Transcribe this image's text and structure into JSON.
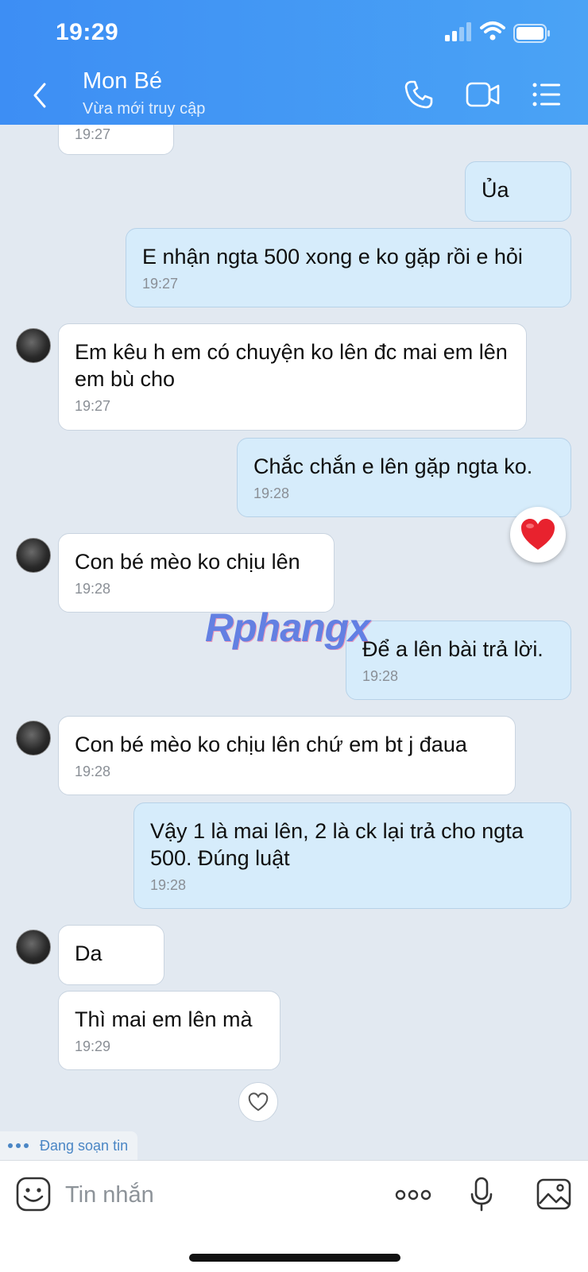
{
  "status_bar": {
    "time": "19:29"
  },
  "header": {
    "contact_name": "Mon Bé",
    "contact_status": "Vừa mới truy cập"
  },
  "messages": [
    {
      "dir": "in",
      "time": "19:27"
    },
    {
      "dir": "out",
      "text": "Ủa"
    },
    {
      "dir": "out",
      "text": "E nhận ngta 500 xong e ko gặp rồi e hỏi",
      "time": "19:27"
    },
    {
      "dir": "in",
      "text": "Em kêu h em có chuyện ko lên đc mai em lên em bù cho",
      "time": "19:27"
    },
    {
      "dir": "out",
      "text": "Chắc chắn e lên gặp ngta ko.",
      "time": "19:28"
    },
    {
      "dir": "in",
      "text": "Con bé mèo ko chịu lên",
      "time": "19:28"
    },
    {
      "dir": "out",
      "text": "Để a lên bài trả lời.",
      "time": "19:28"
    },
    {
      "dir": "in",
      "text": "Con bé mèo ko chịu lên chứ em bt j đaua",
      "time": "19:28"
    },
    {
      "dir": "out",
      "text": "Vậy 1 là mai lên, 2 là ck lại trả cho ngta 500. Đúng luật",
      "time": "19:28"
    },
    {
      "dir": "in",
      "text": "Da"
    },
    {
      "dir": "in",
      "text": "Thì mai em lên mà",
      "time": "19:29"
    }
  ],
  "watermark": "Rphangx",
  "typing_indicator": "Đang soạn tin",
  "composer": {
    "placeholder": "Tin nhắn"
  },
  "icons": {
    "back": "chevron-left-icon",
    "call": "phone-icon",
    "video": "video-camera-icon",
    "menu": "list-menu-icon",
    "sticker": "sticker-face-icon",
    "more": "more-dots-icon",
    "mic": "microphone-icon",
    "photo": "image-icon",
    "reaction_heart": "red-heart-icon",
    "reaction_empty": "heart-outline-icon"
  },
  "colors": {
    "header": "#3d8ef4",
    "outgoing_bubble": "#d6ecfb",
    "incoming_bubble": "#ffffff",
    "chat_bg": "#e2e9f1"
  }
}
